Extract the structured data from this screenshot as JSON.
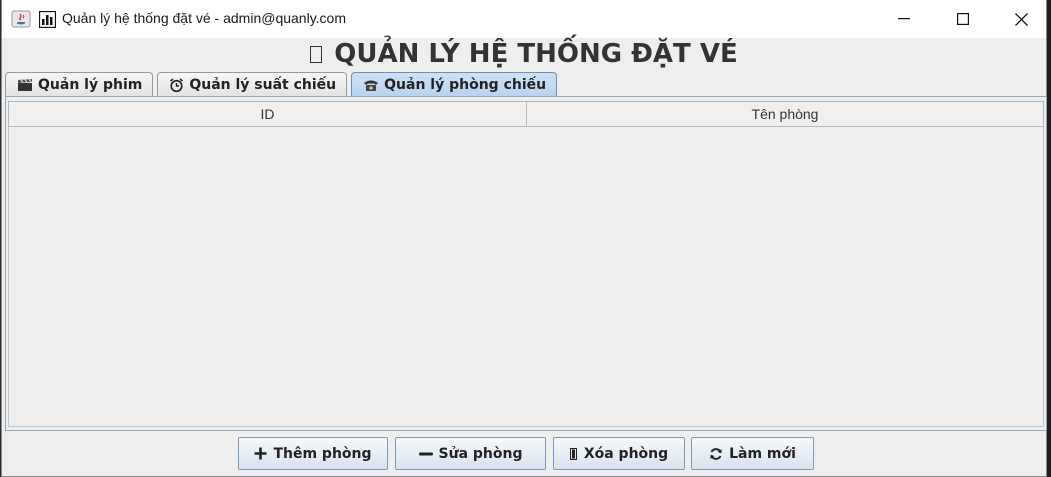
{
  "window": {
    "title": "Quản lý hệ thống đặt vé - admin@quanly.com"
  },
  "header": {
    "title": "QUẢN LÝ HỆ THỐNG ĐẶT VÉ"
  },
  "tabs": [
    {
      "label": "Quản lý phim",
      "icon": "clapperboard-icon",
      "active": false
    },
    {
      "label": "Quản lý suất chiếu",
      "icon": "alarm-clock-icon",
      "active": false
    },
    {
      "label": "Quản lý phòng chiếu",
      "icon": "telephone-icon",
      "active": true
    }
  ],
  "table": {
    "columns": [
      "ID",
      "Tên phòng"
    ],
    "rows": []
  },
  "actions": {
    "add_label": "Thêm phòng",
    "edit_label": "Sửa phòng",
    "delete_label": "Xóa phòng",
    "refresh_label": "Làm mới"
  },
  "colors": {
    "active_tab": "#b8d2ee",
    "background": "#eeeeee"
  }
}
